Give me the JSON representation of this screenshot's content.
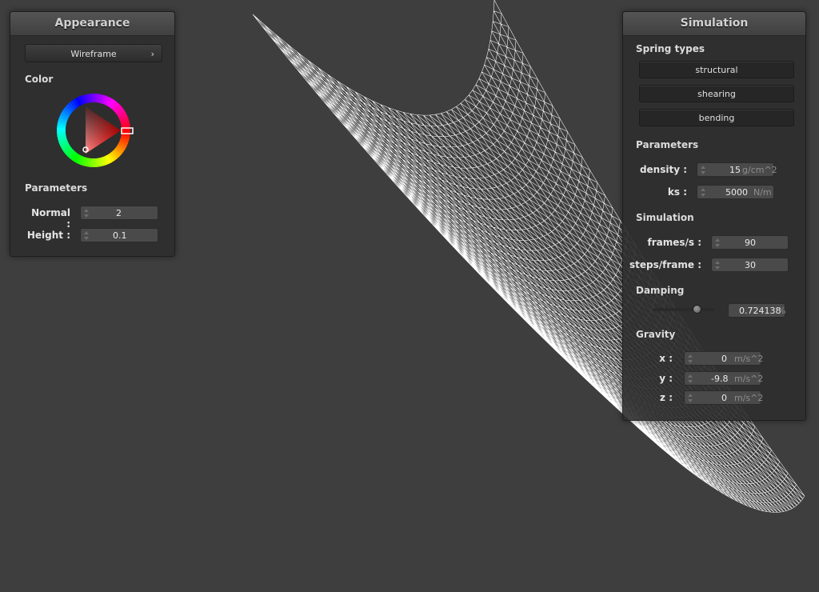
{
  "appearance": {
    "title": "Appearance",
    "mode": "Wireframe",
    "mode_arrow": "›",
    "color_label": "Color",
    "parameters_label": "Parameters",
    "normal_label": "Normal :",
    "normal_value": "2",
    "height_label": "Height :",
    "height_value": "0.1",
    "wheel_hue_color": "#ff0000"
  },
  "simulation": {
    "title": "Simulation",
    "spring_types_label": "Spring types",
    "structural": "structural",
    "shearing": "shearing",
    "bending": "bending",
    "parameters_label": "Parameters",
    "density_label": "density :",
    "density_value": "15",
    "density_unit": "g/cm^2",
    "ks_label": "ks :",
    "ks_value": "5000",
    "ks_unit": "N/m",
    "sim_label": "Simulation",
    "fps_label": "frames/s :",
    "fps_value": "90",
    "steps_label": "steps/frame :",
    "steps_value": "30",
    "damping_label": "Damping",
    "damping_value": "0.724138",
    "damping_unit": "%",
    "gravity_label": "Gravity",
    "gx_label": "x :",
    "gx_value": "0",
    "gy_label": "y :",
    "gy_value": "-9.8",
    "gz_label": "z :",
    "gz_value": "0",
    "gravity_unit": "m/s^2"
  },
  "viewport": {
    "background": "#3e3e3e",
    "mesh_color": "#ffffff"
  }
}
